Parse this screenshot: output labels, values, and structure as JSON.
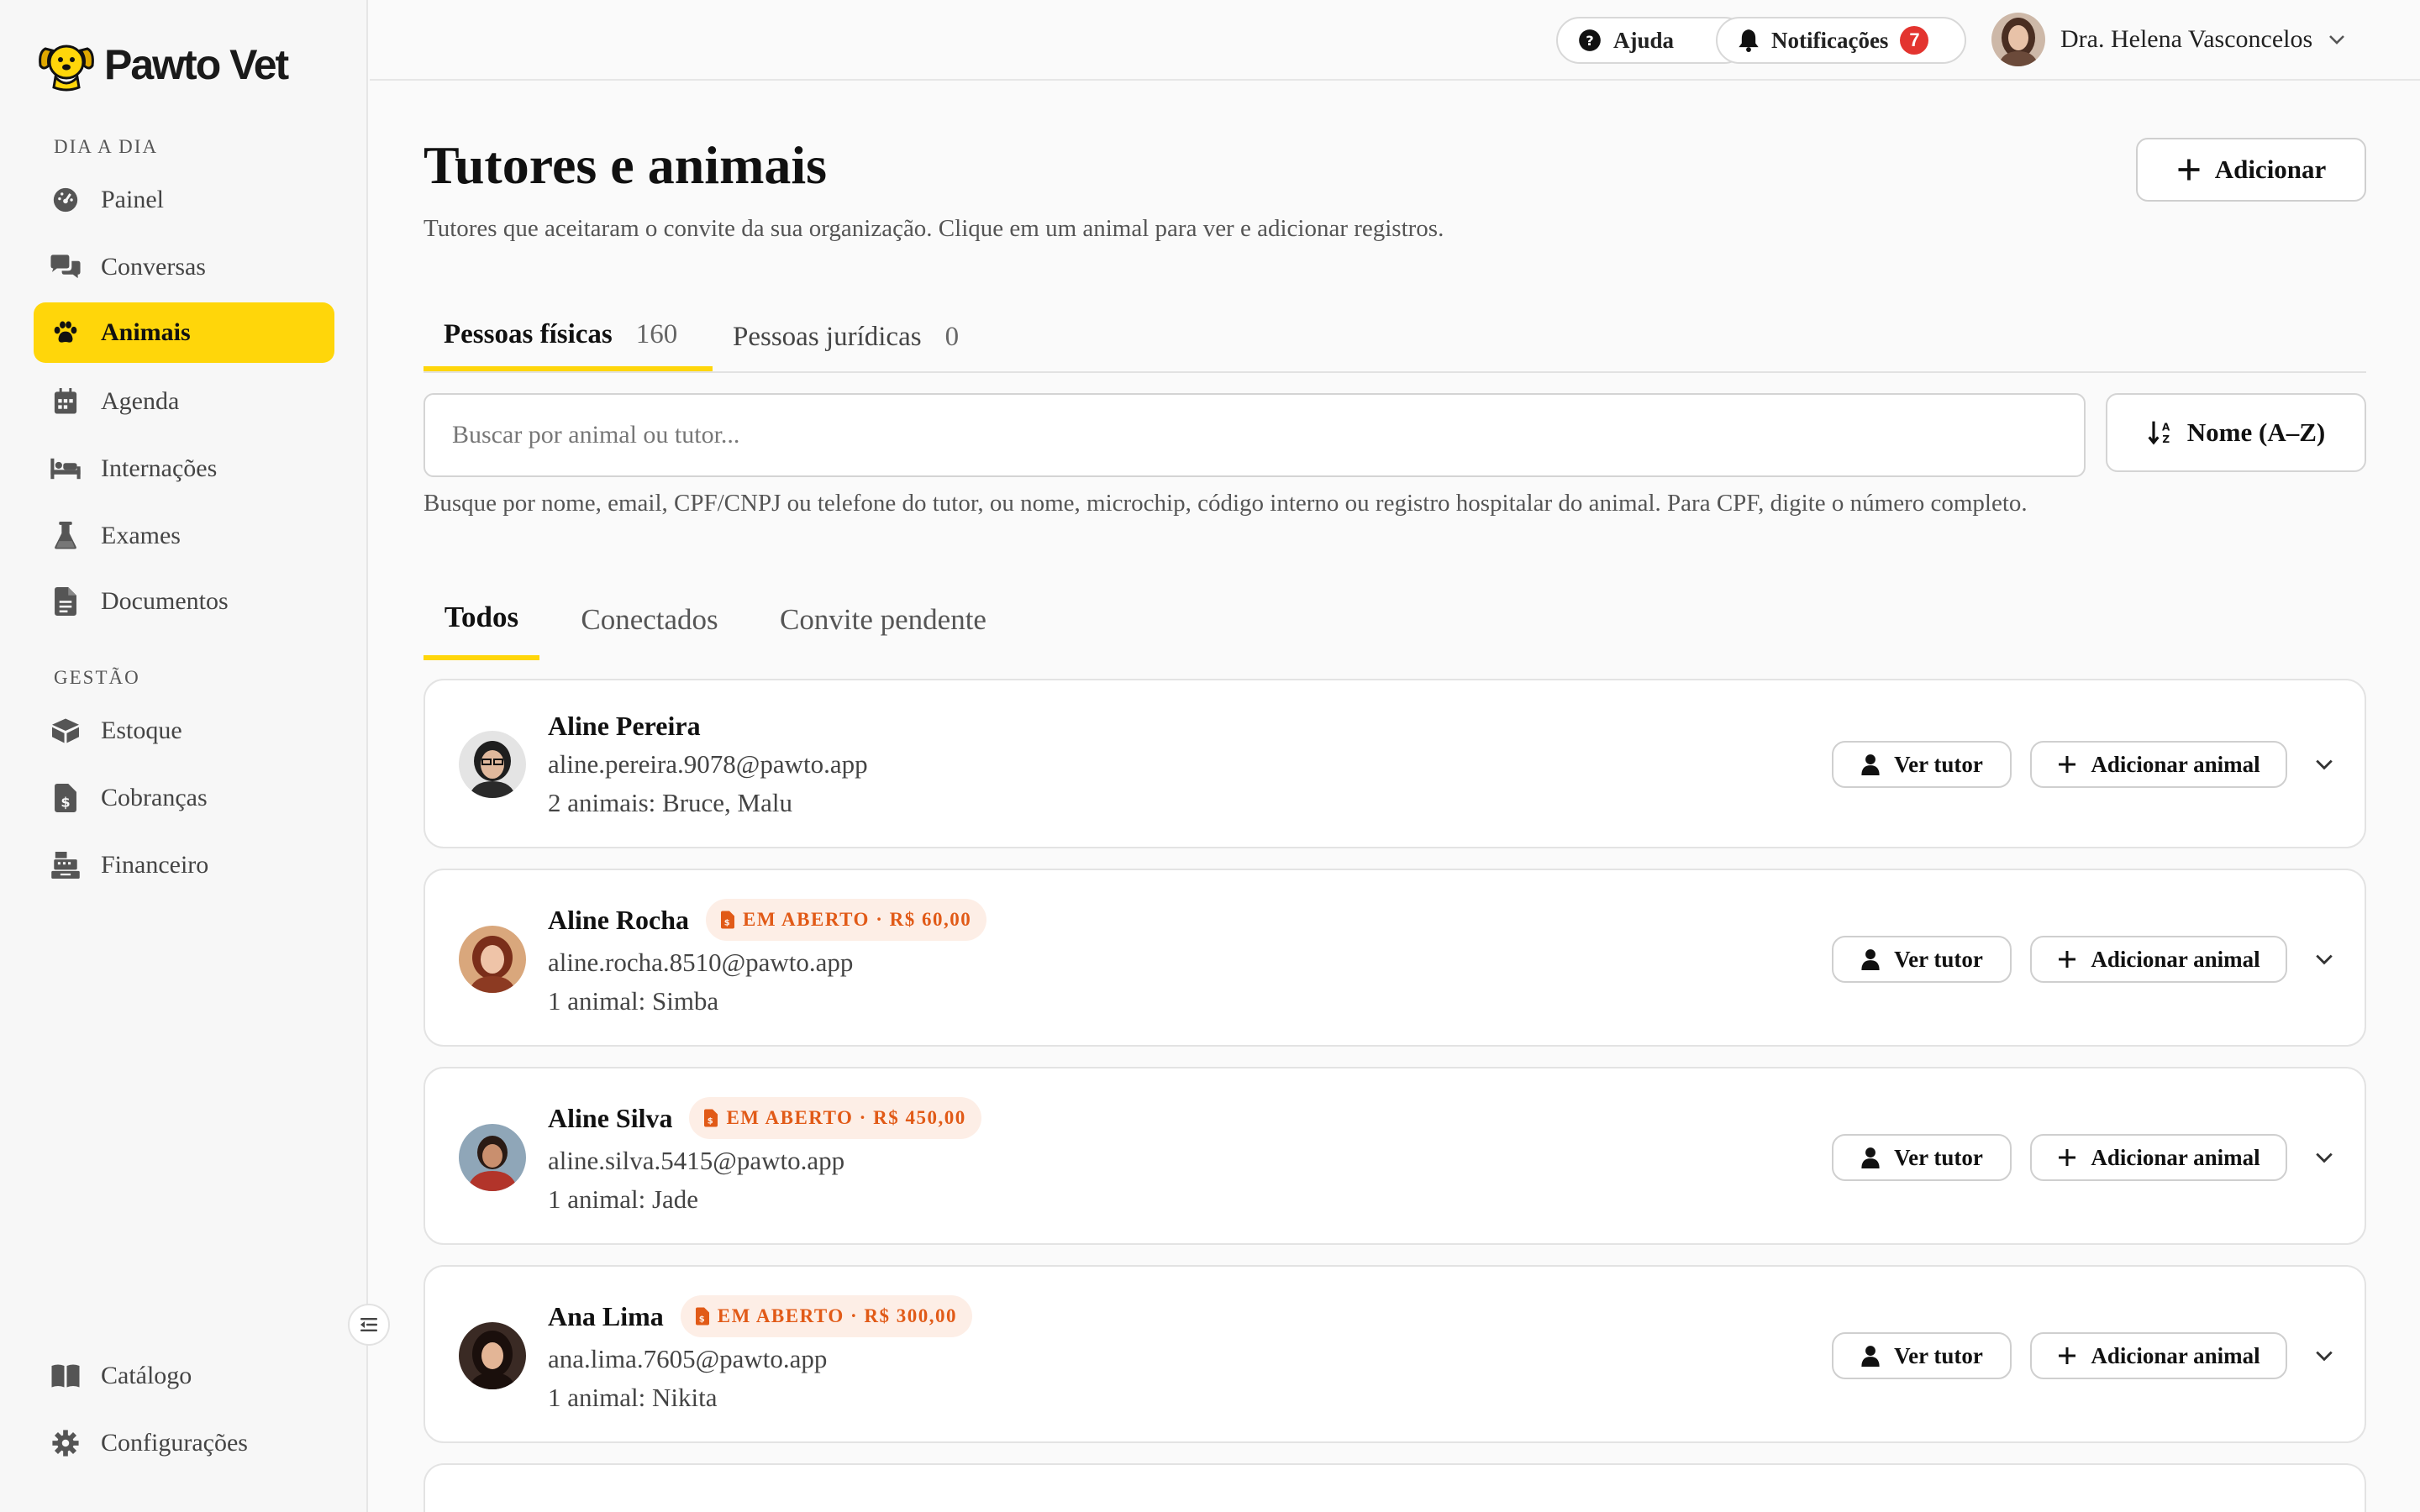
{
  "brand": {
    "name": "Pawto Vet",
    "accent": "#ffd60a"
  },
  "sidebar": {
    "sections": [
      {
        "label": "DIA A DIA"
      },
      {
        "label": "GESTÃO"
      }
    ],
    "items": [
      {
        "label": "Painel",
        "icon": "gauge-icon"
      },
      {
        "label": "Conversas",
        "icon": "chat-icon"
      },
      {
        "label": "Animais",
        "icon": "paw-icon",
        "active": true
      },
      {
        "label": "Agenda",
        "icon": "calendar-icon"
      },
      {
        "label": "Internações",
        "icon": "bed-icon"
      },
      {
        "label": "Exames",
        "icon": "flask-icon"
      },
      {
        "label": "Documentos",
        "icon": "document-icon"
      },
      {
        "label": "Estoque",
        "icon": "box-icon"
      },
      {
        "label": "Cobranças",
        "icon": "invoice-icon"
      },
      {
        "label": "Financeiro",
        "icon": "cash-register-icon"
      },
      {
        "label": "Catálogo",
        "icon": "book-icon"
      },
      {
        "label": "Configurações",
        "icon": "gear-icon"
      }
    ]
  },
  "topbar": {
    "help_label": "Ajuda",
    "notifications_label": "Notificações",
    "notifications_count": "7",
    "user_name": "Dra. Helena Vasconcelos"
  },
  "page": {
    "title": "Tutores e animais",
    "subtitle": "Tutores que aceitaram o convite da sua organização. Clique em um animal para ver e adicionar registros.",
    "add_label": "Adicionar"
  },
  "tabs": [
    {
      "label": "Pessoas físicas",
      "count": "160",
      "active": true
    },
    {
      "label": "Pessoas jurídicas",
      "count": "0",
      "active": false
    }
  ],
  "search": {
    "placeholder": "Buscar por animal ou tutor...",
    "hint": "Busque por nome, email, CPF/CNPJ ou telefone do tutor, ou nome, microchip, código interno ou registro hospitalar do animal. Para CPF, digite o número completo."
  },
  "sort": {
    "label": "Nome (A–Z)"
  },
  "filters": [
    {
      "label": "Todos",
      "active": true
    },
    {
      "label": "Conectados",
      "active": false
    },
    {
      "label": "Convite pendente",
      "active": false
    }
  ],
  "actions": {
    "view_tutor": "Ver tutor",
    "add_animal": "Adicionar animal"
  },
  "tutors": [
    {
      "name": "Aline Pereira",
      "email": "aline.pereira.9078@pawto.app",
      "pets": "2 animais: Bruce, Malu",
      "badge": ""
    },
    {
      "name": "Aline Rocha",
      "email": "aline.rocha.8510@pawto.app",
      "pets": "1 animal: Simba",
      "badge": "EM ABERTO · R$ 60,00"
    },
    {
      "name": "Aline Silva",
      "email": "aline.silva.5415@pawto.app",
      "pets": "1 animal: Jade",
      "badge": "EM ABERTO · R$ 450,00"
    },
    {
      "name": "Ana Lima",
      "email": "ana.lima.7605@pawto.app",
      "pets": "1 animal: Nikita",
      "badge": "EM ABERTO · R$ 300,00"
    }
  ]
}
